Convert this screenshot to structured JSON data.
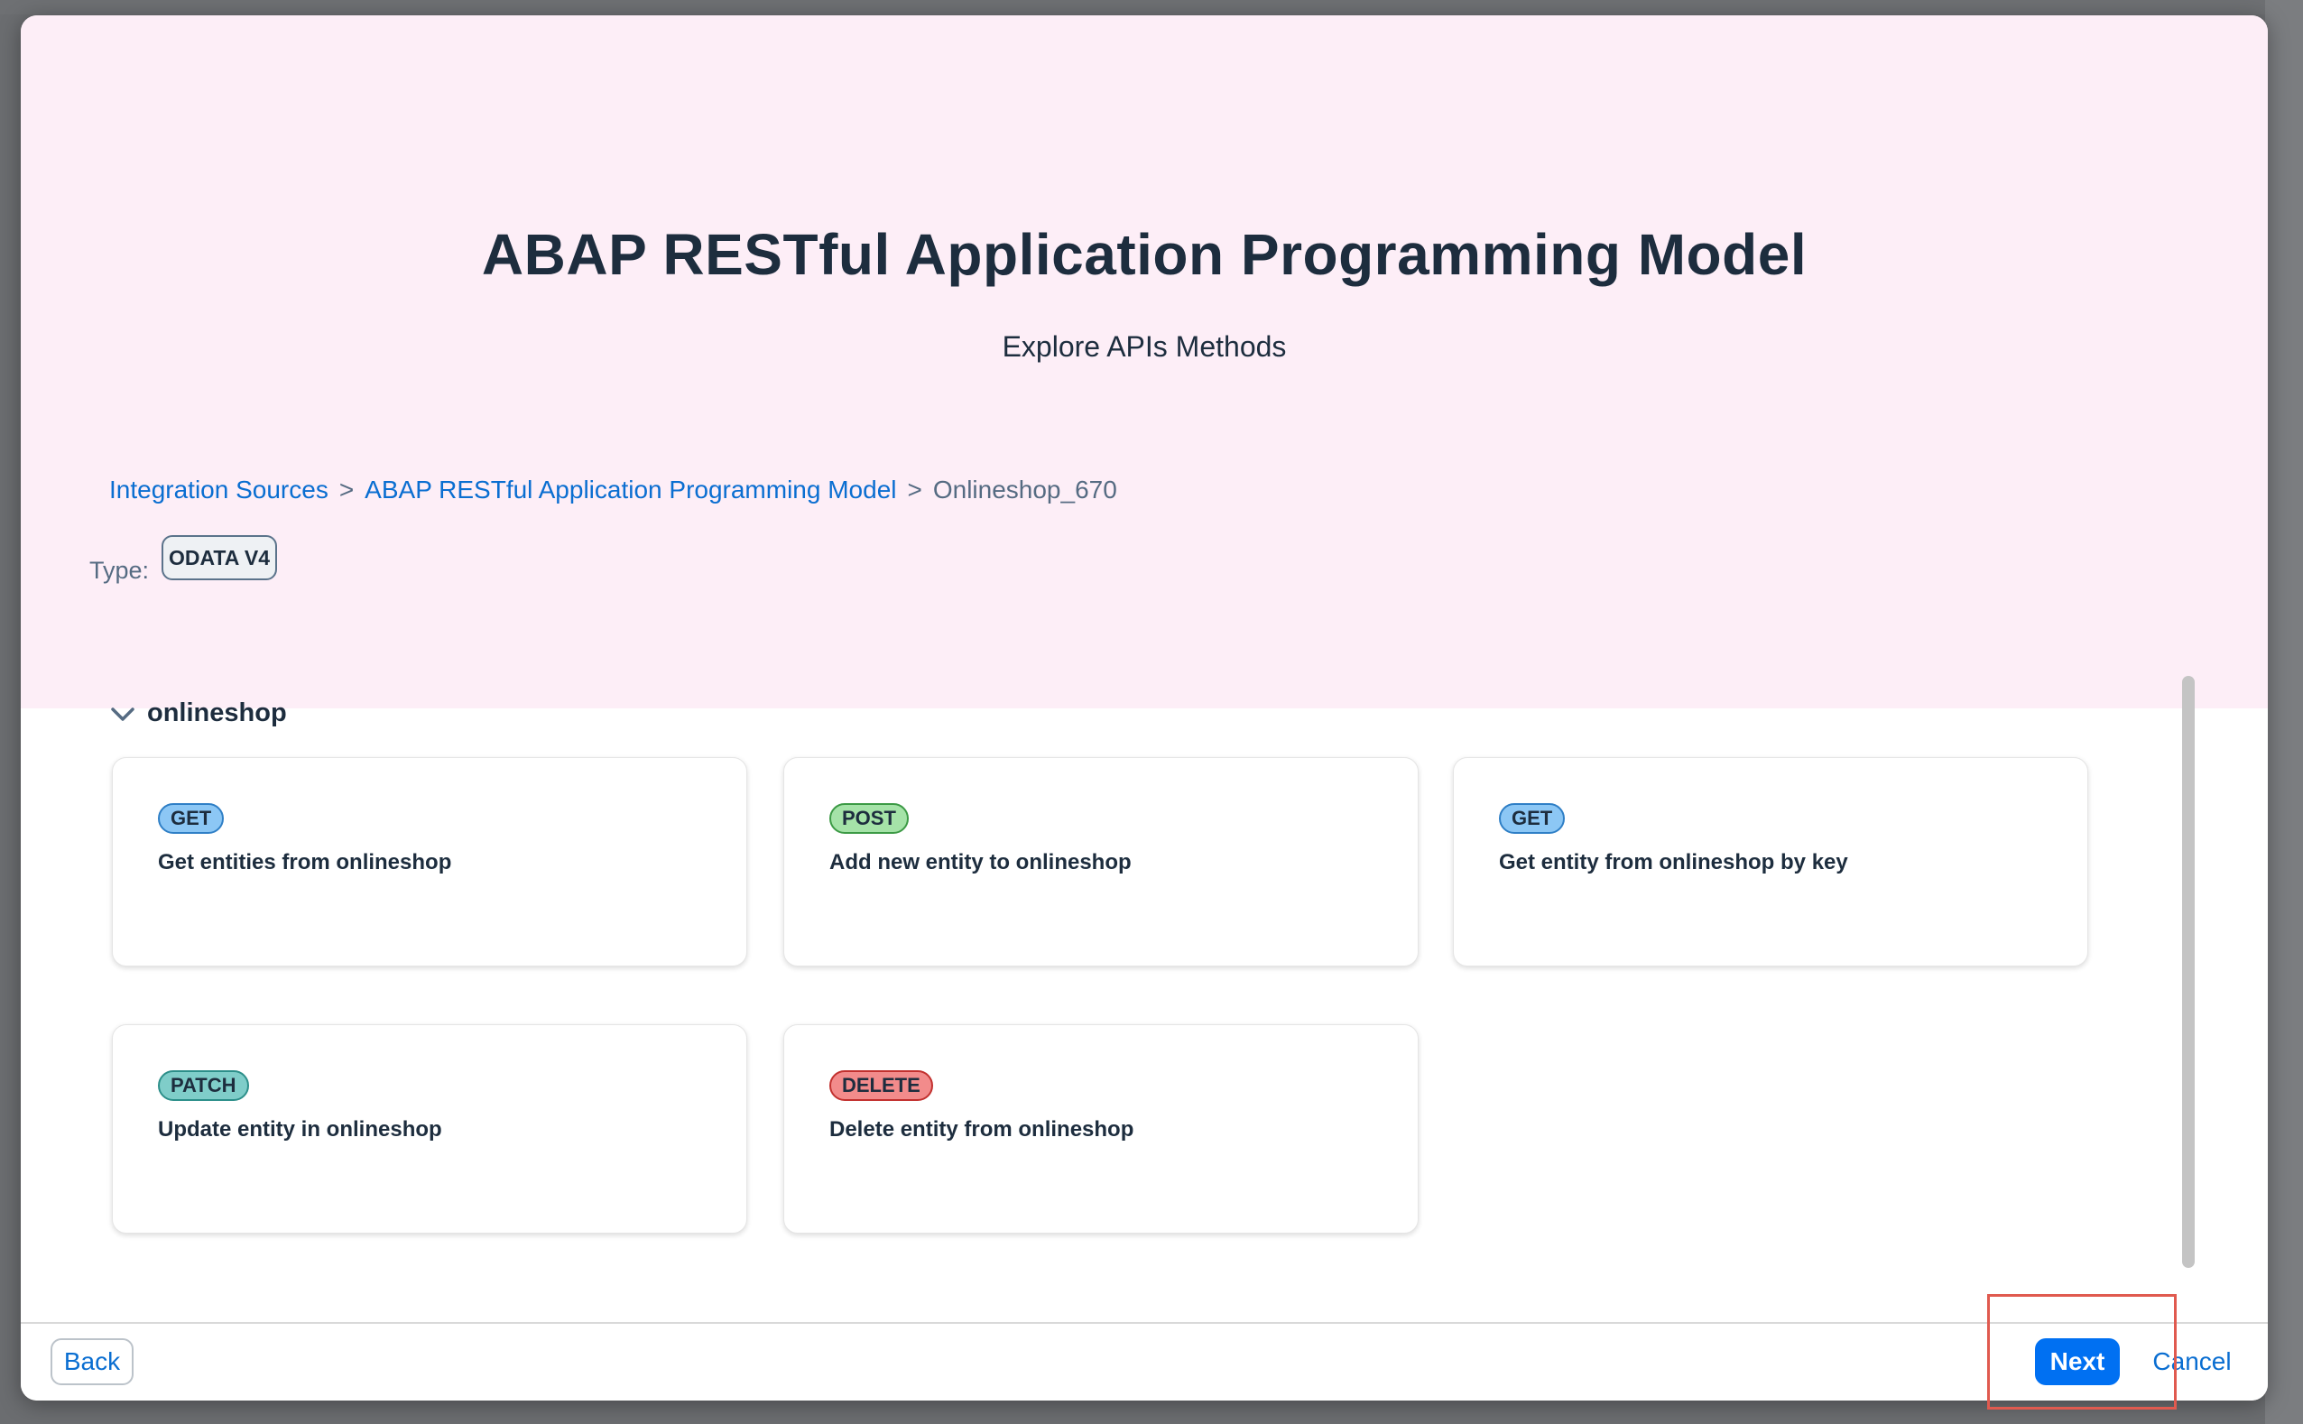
{
  "dialog": {
    "title": "ABAP RESTful Application Programming Model",
    "subtitle": "Explore APIs Methods"
  },
  "breadcrumb": {
    "items": [
      {
        "label": "Integration Sources"
      },
      {
        "label": "ABAP RESTful Application Programming Model"
      },
      {
        "label": "Onlineshop_670"
      }
    ],
    "separator": ">"
  },
  "type": {
    "label": "Type:",
    "value": "ODATA V4"
  },
  "group": {
    "title": "onlineshop",
    "icon": "chevron-down-icon"
  },
  "methods": [
    {
      "method": "GET",
      "description": "Get entities from onlineshop"
    },
    {
      "method": "POST",
      "description": "Add new entity to onlineshop"
    },
    {
      "method": "GET",
      "description": "Get entity from onlineshop by key"
    },
    {
      "method": "PATCH",
      "description": "Update entity in onlineshop"
    },
    {
      "method": "DELETE",
      "description": "Delete entity from onlineshop"
    }
  ],
  "colors": {
    "header_bg": "#fdeef7",
    "get": "#8cc7f5",
    "post": "#a5e3a8",
    "patch": "#7fcdc9",
    "delete": "#f28b8b",
    "primary": "#0070f2",
    "highlight": "#e05a4f"
  },
  "footer": {
    "back_label": "Back",
    "next_label": "Next",
    "cancel_label": "Cancel"
  }
}
